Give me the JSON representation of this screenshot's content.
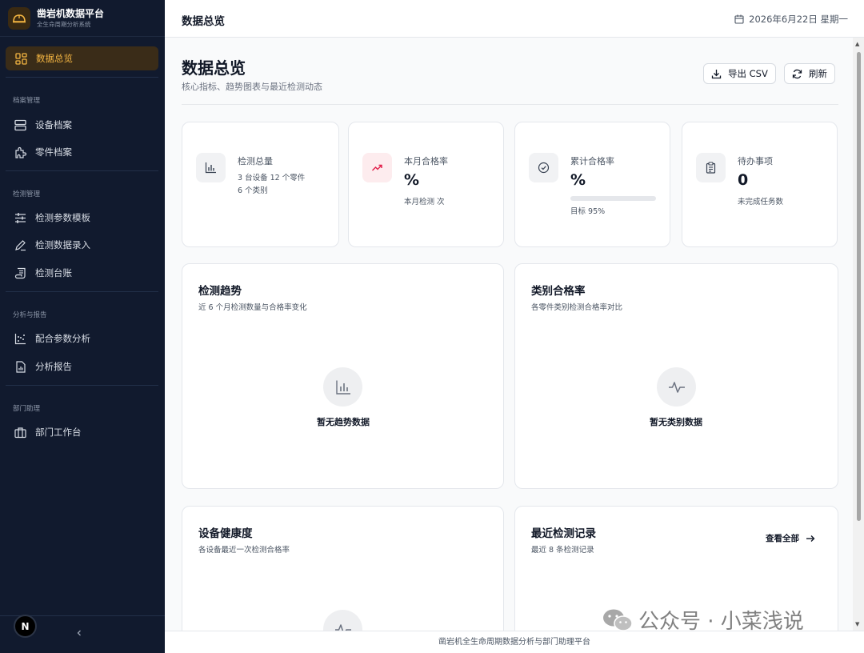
{
  "brand": {
    "title": "凿岩机数据平台",
    "subtitle": "全生命周期分析系统"
  },
  "sidebar": {
    "active_item": "数据总览",
    "groups": [
      {
        "label": "档案管理",
        "items": [
          "设备档案",
          "零件档案"
        ]
      },
      {
        "label": "检测管理",
        "items": [
          "检测参数模板",
          "检测数据录入",
          "检测台账"
        ]
      },
      {
        "label": "分析与报告",
        "items": [
          "配合参数分析",
          "分析报告"
        ]
      },
      {
        "label": "部门助理",
        "items": [
          "部门工作台"
        ]
      }
    ],
    "avatar_letter": "N",
    "collapse_icon": "chevron-left-icon"
  },
  "topbar": {
    "title": "数据总览",
    "date": "2026年6月22日 星期一"
  },
  "page": {
    "title": "数据总览",
    "subtitle": "核心指标、趋势图表与最近检测动态",
    "export_label": "导出 CSV",
    "refresh_label": "刷新"
  },
  "stats": [
    {
      "label": "检测总量",
      "meta_line1": "3 台设备 12 个零件",
      "meta_line2": "6 个类别",
      "icon": "bar-chart-icon"
    },
    {
      "label": "本月合格率",
      "value": "%",
      "meta": "本月检测 次",
      "icon": "trending-up-icon",
      "accent": "#e11d48"
    },
    {
      "label": "累计合格率",
      "value": "%",
      "meta": "目标 95%",
      "progress": 0.0,
      "icon": "check-circle-icon"
    },
    {
      "label": "待办事项",
      "value": "0",
      "meta": "未完成任务数",
      "icon": "clipboard-icon"
    }
  ],
  "panels": {
    "trend": {
      "title": "检测趋势",
      "subtitle": "近 6 个月检测数量与合格率变化",
      "empty": "暂无趋势数据"
    },
    "category": {
      "title": "类别合格率",
      "subtitle": "各零件类别检测合格率对比",
      "empty": "暂无类别数据"
    },
    "health": {
      "title": "设备健康度",
      "subtitle": "各设备最近一次检测合格率"
    },
    "recent": {
      "title": "最近检测记录",
      "subtitle": "最近 8 条检测记录",
      "view_all": "查看全部"
    }
  },
  "footer": {
    "text": "凿岩机全生命周期数据分析与部门助理平台"
  },
  "watermark": {
    "text": "公众号 · 小菜浅说"
  },
  "colors": {
    "sidebar_bg": "#111a2e",
    "accent": "#f5b642",
    "active_bg": "#3a2c18"
  }
}
